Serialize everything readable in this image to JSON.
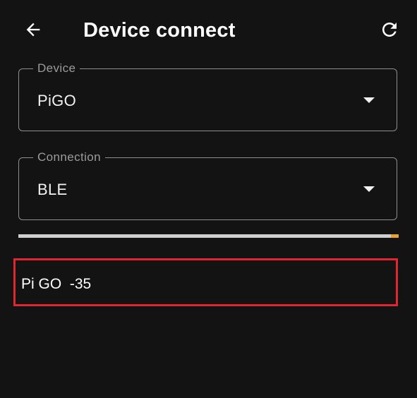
{
  "header": {
    "title": "Device connect",
    "back_icon": "arrow-left-icon",
    "refresh_icon": "refresh-icon"
  },
  "device_field": {
    "label": "Device",
    "value": "PiGO"
  },
  "connection_field": {
    "label": "Connection",
    "value": "BLE"
  },
  "scan_progress": {
    "fraction": 0.02,
    "track_color": "#cfcfcf",
    "fill_color": "#e9a430"
  },
  "device_list": [
    {
      "text": "Pi GO  -35"
    }
  ],
  "colors": {
    "background": "#131313",
    "highlight_border": "#e0262e"
  }
}
